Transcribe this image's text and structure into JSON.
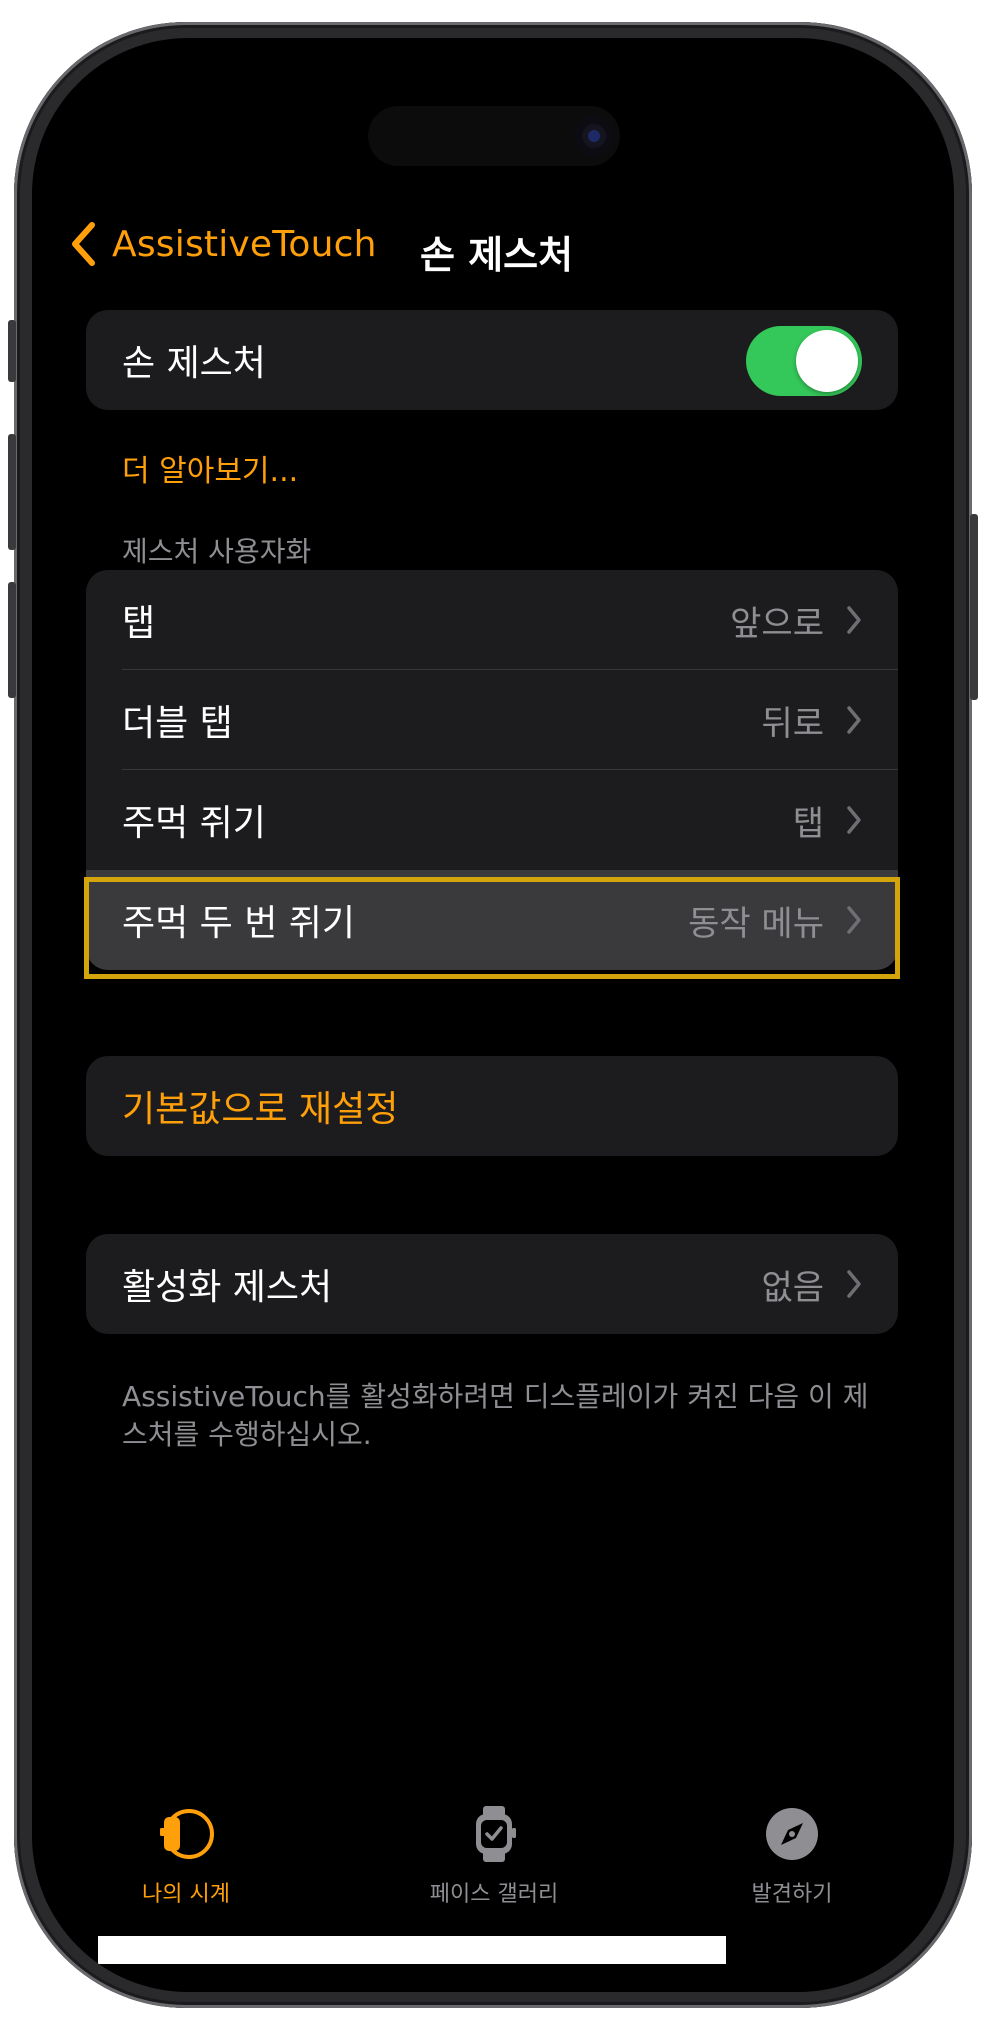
{
  "nav": {
    "back_label": "AssistiveTouch",
    "title": "손 제스처"
  },
  "hand_gestures": {
    "label": "손 제스처",
    "enabled": true,
    "learn_more": "더 알아보기..."
  },
  "customize_section": {
    "header": "제스처 사용자화",
    "rows": [
      {
        "title": "탭",
        "value": "앞으로"
      },
      {
        "title": "더블 탭",
        "value": "뒤로"
      },
      {
        "title": "주먹 쥐기",
        "value": "탭"
      },
      {
        "title": "주먹 두 번 쥐기",
        "value": "동작 메뉴"
      }
    ]
  },
  "reset": {
    "label": "기본값으로 재설정"
  },
  "activation": {
    "title": "활성화 제스처",
    "value": "없음",
    "footnote": "AssistiveTouch를 활성화하려면 디스플레이가 켜진 다음 이 제스처를 수행하십시오."
  },
  "tabbar": {
    "tabs": [
      {
        "label": "나의 시계",
        "icon": "watch-side-icon",
        "active": true
      },
      {
        "label": "페이스 갤러리",
        "icon": "watch-face-icon",
        "active": false
      },
      {
        "label": "발견하기",
        "icon": "compass-icon",
        "active": false
      }
    ]
  },
  "colors": {
    "accent": "#ff9f0a",
    "toggle_on": "#34c759",
    "background": "#000000",
    "cell": "#1c1c1e",
    "secondary_text": "#8e8e93",
    "highlight_border": "#d4a40c"
  }
}
